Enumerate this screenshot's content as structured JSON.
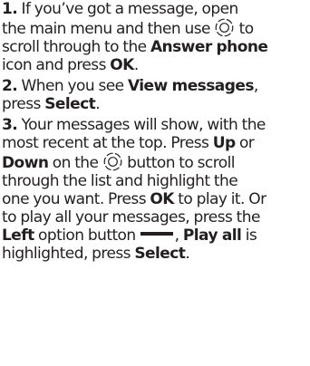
{
  "steps": [
    {
      "number": "1.",
      "l1_a": " If you’ve got a message, open",
      "l2_a": "the main menu and then use",
      "l2_b": "to",
      "l3_a": "scroll through to the",
      "l3_b": "Answer phone",
      "l4_a": "icon and press",
      "l4_b": "OK",
      "l4_c": "."
    },
    {
      "number": "2.",
      "l1_a": " When you see",
      "l1_b": "View messages",
      "l1_c": ",",
      "l2_a": "press",
      "l2_b": "Select",
      "l2_c": "."
    },
    {
      "number": "3.",
      "l1_a": " Your messages will show, with the",
      "l2_a": "most recent at the top. Press",
      "l2_b": "Up",
      "l2_c": "or",
      "l3_a": "Down",
      "l3_b": "on the",
      "l3_c": "button to scroll",
      "l4_a": "through the list and highlight the",
      "l5_a": "one you want. Press",
      "l5_b": "OK",
      "l5_c": "to play it. Or",
      "l6_a": "to play all your messages, press the",
      "l7_a": "Left",
      "l7_b": "option button",
      "l7_c": ",",
      "l7_d": "Play all",
      "l7_e": "is",
      "l8_a": "highlighted, press",
      "l8_b": "Select",
      "l8_c": "."
    }
  ],
  "icons": {
    "navigation": "navigation-key-icon",
    "option_button": "left-option-button-icon"
  }
}
